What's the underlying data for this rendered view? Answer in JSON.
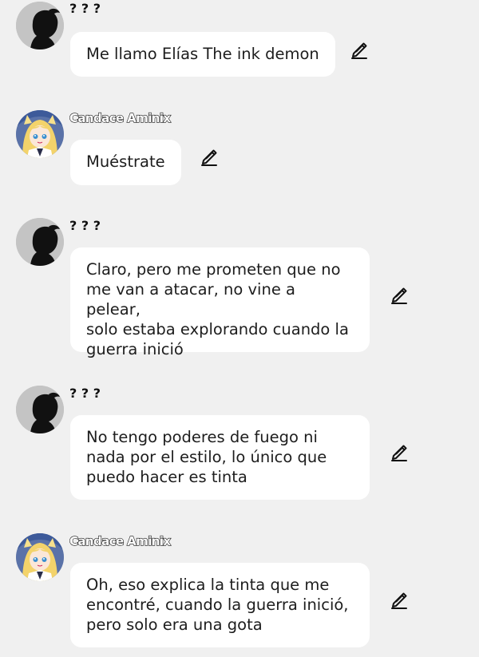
{
  "messages": [
    {
      "sender": "? ? ?",
      "text": "Me llamo Elías The ink demon",
      "avatar": "silhouette-avatar",
      "action_icon": "edit-pencil-icon"
    },
    {
      "sender": "Candace Aminix",
      "text": "Muéstrate",
      "avatar": "anime-girl-avatar",
      "action_icon": "edit-pencil-icon"
    },
    {
      "sender": "? ? ?",
      "text": "Claro, pero me prometen que no\nme van a atacar, no vine a pelear,\nsolo estaba explorando cuando la\nguerra inició",
      "avatar": "silhouette-avatar",
      "action_icon": "edit-pencil-icon"
    },
    {
      "sender": "? ? ?",
      "text": "No tengo poderes de fuego ni\nnada por el estilo, lo único que\npuedo hacer es tinta",
      "avatar": "silhouette-avatar",
      "action_icon": "edit-pencil-icon"
    },
    {
      "sender": "Candace Aminix",
      "text": "Oh, eso explica la tinta que me\nencontré, cuando la guerra inició,\npero solo era una gota",
      "avatar": "anime-girl-avatar",
      "action_icon": "edit-pencil-icon"
    }
  ],
  "colors": {
    "background": "#f0f0f0",
    "bubble": "#ffffff",
    "text": "#1d1d1d"
  }
}
